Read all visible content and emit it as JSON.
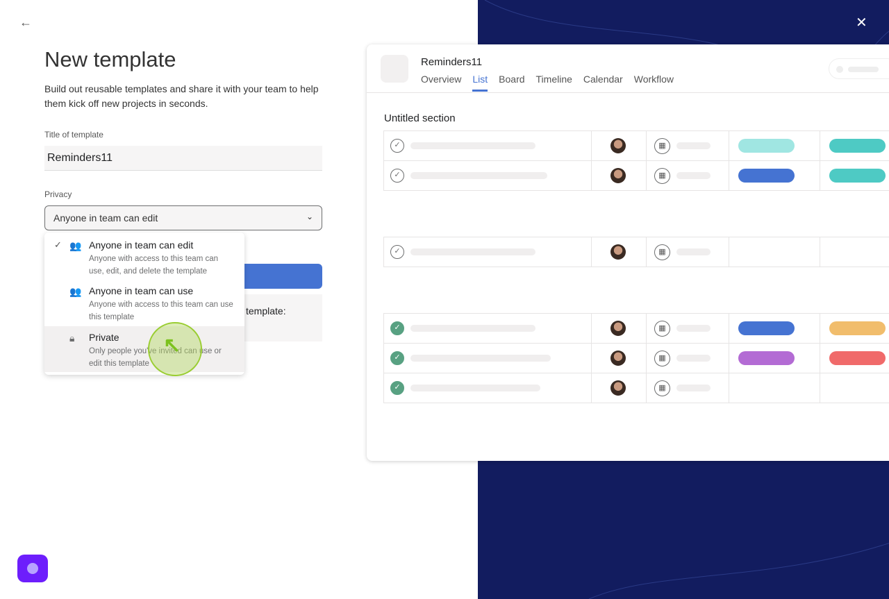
{
  "header": {
    "back_icon": "arrow-left-icon",
    "close_icon": "close-icon"
  },
  "form": {
    "title": "New template",
    "description": "Build out reusable templates and share it with your team to help them kick off new projects in seconds.",
    "title_label": "Title of template",
    "title_value": "Reminders11",
    "privacy_label": "Privacy",
    "privacy_value": "Anyone in team can edit",
    "hidden_text": "template:"
  },
  "dropdown": {
    "options": [
      {
        "label": "Anyone in team can edit",
        "desc": "Anyone with access to this team can use, edit, and delete the template",
        "icon": "people-icon",
        "selected": true
      },
      {
        "label": "Anyone in team can use",
        "desc": "Anyone with access to this team can use this template",
        "icon": "people-icon",
        "selected": false
      },
      {
        "label": "Private",
        "desc": "Only people you've invited can use or edit this template",
        "icon": "lock-icon",
        "selected": false
      }
    ]
  },
  "preview": {
    "project_name": "Reminders11",
    "tabs": [
      "Overview",
      "List",
      "Board",
      "Timeline",
      "Calendar",
      "Workflow"
    ],
    "active_tab": "List",
    "section": "Untitled section",
    "rows": [
      {
        "done": false,
        "pills": [
          "#a0e6e2",
          "#4ecac4"
        ]
      },
      {
        "done": false,
        "pills": [
          "#4573d2",
          "#4ecac4"
        ]
      },
      {
        "done": false,
        "pills": []
      },
      {
        "done": true,
        "pills": [
          "#4573d2",
          "#f1bd6c"
        ]
      },
      {
        "done": true,
        "pills": [
          "#b36bd4",
          "#f06a6a"
        ]
      },
      {
        "done": true,
        "pills": []
      }
    ]
  },
  "colors": {
    "accent": "#4573d2",
    "navy": "#121c5f",
    "chat": "#6d1efc"
  }
}
